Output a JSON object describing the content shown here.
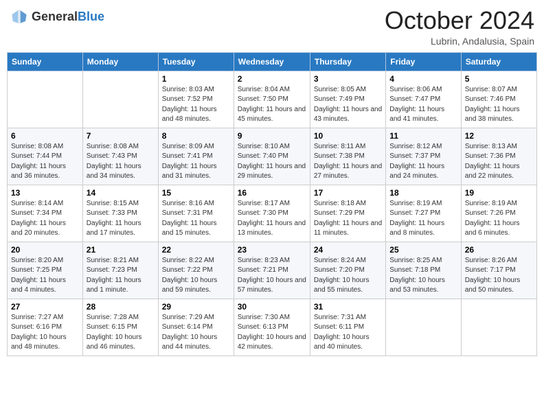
{
  "header": {
    "logo_general": "General",
    "logo_blue": "Blue",
    "month_title": "October 2024",
    "location": "Lubrin, Andalusia, Spain"
  },
  "weekdays": [
    "Sunday",
    "Monday",
    "Tuesday",
    "Wednesday",
    "Thursday",
    "Friday",
    "Saturday"
  ],
  "weeks": [
    [
      {
        "day": "",
        "info": ""
      },
      {
        "day": "",
        "info": ""
      },
      {
        "day": "1",
        "info": "Sunrise: 8:03 AM\nSunset: 7:52 PM\nDaylight: 11 hours and 48 minutes."
      },
      {
        "day": "2",
        "info": "Sunrise: 8:04 AM\nSunset: 7:50 PM\nDaylight: 11 hours and 45 minutes."
      },
      {
        "day": "3",
        "info": "Sunrise: 8:05 AM\nSunset: 7:49 PM\nDaylight: 11 hours and 43 minutes."
      },
      {
        "day": "4",
        "info": "Sunrise: 8:06 AM\nSunset: 7:47 PM\nDaylight: 11 hours and 41 minutes."
      },
      {
        "day": "5",
        "info": "Sunrise: 8:07 AM\nSunset: 7:46 PM\nDaylight: 11 hours and 38 minutes."
      }
    ],
    [
      {
        "day": "6",
        "info": "Sunrise: 8:08 AM\nSunset: 7:44 PM\nDaylight: 11 hours and 36 minutes."
      },
      {
        "day": "7",
        "info": "Sunrise: 8:08 AM\nSunset: 7:43 PM\nDaylight: 11 hours and 34 minutes."
      },
      {
        "day": "8",
        "info": "Sunrise: 8:09 AM\nSunset: 7:41 PM\nDaylight: 11 hours and 31 minutes."
      },
      {
        "day": "9",
        "info": "Sunrise: 8:10 AM\nSunset: 7:40 PM\nDaylight: 11 hours and 29 minutes."
      },
      {
        "day": "10",
        "info": "Sunrise: 8:11 AM\nSunset: 7:38 PM\nDaylight: 11 hours and 27 minutes."
      },
      {
        "day": "11",
        "info": "Sunrise: 8:12 AM\nSunset: 7:37 PM\nDaylight: 11 hours and 24 minutes."
      },
      {
        "day": "12",
        "info": "Sunrise: 8:13 AM\nSunset: 7:36 PM\nDaylight: 11 hours and 22 minutes."
      }
    ],
    [
      {
        "day": "13",
        "info": "Sunrise: 8:14 AM\nSunset: 7:34 PM\nDaylight: 11 hours and 20 minutes."
      },
      {
        "day": "14",
        "info": "Sunrise: 8:15 AM\nSunset: 7:33 PM\nDaylight: 11 hours and 17 minutes."
      },
      {
        "day": "15",
        "info": "Sunrise: 8:16 AM\nSunset: 7:31 PM\nDaylight: 11 hours and 15 minutes."
      },
      {
        "day": "16",
        "info": "Sunrise: 8:17 AM\nSunset: 7:30 PM\nDaylight: 11 hours and 13 minutes."
      },
      {
        "day": "17",
        "info": "Sunrise: 8:18 AM\nSunset: 7:29 PM\nDaylight: 11 hours and 11 minutes."
      },
      {
        "day": "18",
        "info": "Sunrise: 8:19 AM\nSunset: 7:27 PM\nDaylight: 11 hours and 8 minutes."
      },
      {
        "day": "19",
        "info": "Sunrise: 8:19 AM\nSunset: 7:26 PM\nDaylight: 11 hours and 6 minutes."
      }
    ],
    [
      {
        "day": "20",
        "info": "Sunrise: 8:20 AM\nSunset: 7:25 PM\nDaylight: 11 hours and 4 minutes."
      },
      {
        "day": "21",
        "info": "Sunrise: 8:21 AM\nSunset: 7:23 PM\nDaylight: 11 hours and 1 minute."
      },
      {
        "day": "22",
        "info": "Sunrise: 8:22 AM\nSunset: 7:22 PM\nDaylight: 10 hours and 59 minutes."
      },
      {
        "day": "23",
        "info": "Sunrise: 8:23 AM\nSunset: 7:21 PM\nDaylight: 10 hours and 57 minutes."
      },
      {
        "day": "24",
        "info": "Sunrise: 8:24 AM\nSunset: 7:20 PM\nDaylight: 10 hours and 55 minutes."
      },
      {
        "day": "25",
        "info": "Sunrise: 8:25 AM\nSunset: 7:18 PM\nDaylight: 10 hours and 53 minutes."
      },
      {
        "day": "26",
        "info": "Sunrise: 8:26 AM\nSunset: 7:17 PM\nDaylight: 10 hours and 50 minutes."
      }
    ],
    [
      {
        "day": "27",
        "info": "Sunrise: 7:27 AM\nSunset: 6:16 PM\nDaylight: 10 hours and 48 minutes."
      },
      {
        "day": "28",
        "info": "Sunrise: 7:28 AM\nSunset: 6:15 PM\nDaylight: 10 hours and 46 minutes."
      },
      {
        "day": "29",
        "info": "Sunrise: 7:29 AM\nSunset: 6:14 PM\nDaylight: 10 hours and 44 minutes."
      },
      {
        "day": "30",
        "info": "Sunrise: 7:30 AM\nSunset: 6:13 PM\nDaylight: 10 hours and 42 minutes."
      },
      {
        "day": "31",
        "info": "Sunrise: 7:31 AM\nSunset: 6:11 PM\nDaylight: 10 hours and 40 minutes."
      },
      {
        "day": "",
        "info": ""
      },
      {
        "day": "",
        "info": ""
      }
    ]
  ]
}
